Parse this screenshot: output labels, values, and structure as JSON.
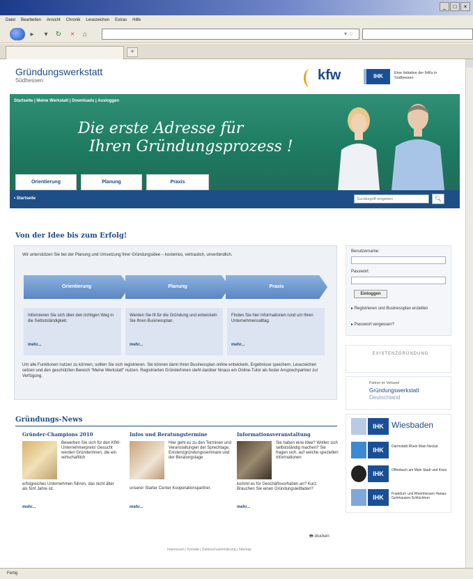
{
  "browser": {
    "window_buttons": [
      "_",
      "□",
      "×"
    ],
    "menu": [
      "Datei",
      "Bearbeiten",
      "Ansicht",
      "Chronik",
      "Lesezeichen",
      "Extras",
      "Hilfe"
    ],
    "url_value": "",
    "search_value": "",
    "status_text": "Fertig"
  },
  "header": {
    "brand_title": "Gründungswerkstatt",
    "brand_subtitle": "Südhessen",
    "kfw_logo": "kfw",
    "ihk_logo": "IHK",
    "ihk_text": "Eine Initiative der IHKs in Südhessen"
  },
  "banner": {
    "top_nav": "Startseite  |  Meine Werkstatt  |  Downloads  |  Ausloggen",
    "slogan_line1": "Die erste Adresse für",
    "slogan_line2": "Ihren Gründungsprozess !",
    "tabs": [
      "Orientierung",
      "Planung",
      "Praxis"
    ]
  },
  "breadcrumb": "• Startseite",
  "search": {
    "placeholder": "Suchbegriff eingeben",
    "button_icon": "search-icon"
  },
  "main": {
    "heading": "Von der Idee bis zum Erfolg!",
    "intro": "Wir unterstützen Sie bei der Planung und Umsetzung Ihrer Gründungsidee – kostenlos, vertraulich, unverbindlich.",
    "steps": [
      "Orientierung",
      "Planung",
      "Praxis"
    ],
    "columns": [
      {
        "text": "Informieren Sie sich über den richtigen Weg in die Selbstständigkeit.",
        "more": "mehr..."
      },
      {
        "text": "Werden Sie fit für die Gründung und entwickeln Sie Ihren Businessplan.",
        "more": "mehr..."
      },
      {
        "text": "Finden Sie hier Informationen rund um Ihren Unternehmensalltag.",
        "more": "mehr..."
      }
    ],
    "bottom_text": "Um alle Funktionen nutzen zu können, sollten Sie sich registrieren. Sie können dann Ihren Businessplan online entwickeln, Ergebnisse speichern, Lesezeichen setzen und den geschützten Bereich \"Meine Werkstatt\" nutzen. Registrierten GründerInnen steht darüber hinaus ein Online-Tutor als fester Ansprechpartner zur Verfügung."
  },
  "login": {
    "username_label": "Benutzername:",
    "password_label": "Passwort:",
    "login_button": "Einloggen",
    "register_link": "Registrieren und Businessplan erstellen",
    "forgot_link": "Passwort vergessen?"
  },
  "sidebar": {
    "logo1_text": "EXISTENZGRÜNDUNG",
    "partner_label": "Partner im Verbund",
    "partner_name1": "Gründungswerkstatt",
    "partner_name2": "Deutschland",
    "ihk_wiesbaden": "Wiesbaden",
    "ihk_rows": [
      {
        "label": "IHK",
        "text": "Darmstadt Rhein Main Neckar"
      },
      {
        "label": "IHK",
        "text": "Offenbach am Main Stadt und Kreis"
      },
      {
        "label": "IHK",
        "text": "Frankfurt- und Rheinhessen Hanau-Gelnhausen-Schlüchtern"
      }
    ]
  },
  "news": {
    "heading": "Gründungs-News",
    "items": [
      {
        "title": "Gründer-Champions 2010",
        "text": "Bewerben Sie sich für den KfW-Unternehmerpreis! Gesucht werden Gründerinnen, die ein wirtschaftlich",
        "full": "erfolgreiches Unternehmen führen, das nicht älter als fünf Jahre ist.",
        "more": "mehr..."
      },
      {
        "title": "Infos und Beratungstermine",
        "text": "Hier geht es zu den Terminen und Veranstaltungen der Sprechtage, Existenzgründungsseminare und der Beratungstage",
        "full": "unserer Starter Center Kooperationspartner.",
        "more": "mehr..."
      },
      {
        "title": "Informationsveranstaltung",
        "text": "Sie haben eine Idee? Wollen sich selbstständig machen? Sie fragen sich, auf welche speziellen Informationen",
        "full": "kommt es für Geschäftsvorhaben an? Kurz: Brauchen Sie einen Gründungsleitfaden?",
        "more": "mehr..."
      }
    ]
  },
  "footer": {
    "print": "drucken",
    "links": "Impressum | Kontakt | Datenschutzerklärung | Sitemap"
  },
  "colors": {
    "banner_green": "#1d7a60",
    "brand_blue": "#1e4e86",
    "kfw_orange": "#e4a316"
  }
}
